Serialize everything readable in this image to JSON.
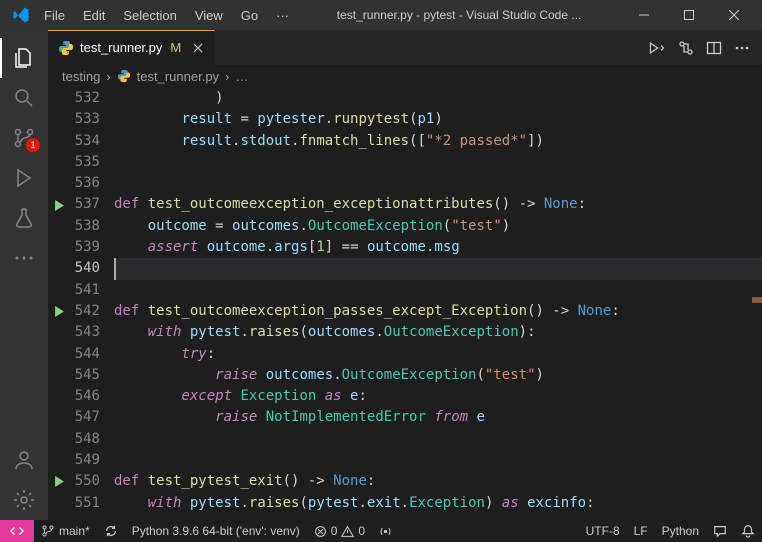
{
  "window": {
    "title": "test_runner.py - pytest - Visual Studio Code ..."
  },
  "menu": {
    "file": "File",
    "edit": "Edit",
    "selection": "Selection",
    "view": "View",
    "go": "Go",
    "more": "···"
  },
  "activity": {
    "scm_badge": "1"
  },
  "tab": {
    "filename": "test_runner.py",
    "modified_marker": "M"
  },
  "breadcrumb": {
    "folder": "testing",
    "file": "test_runner.py",
    "more": "…"
  },
  "editor": {
    "lines": [
      {
        "n": "532",
        "play": false,
        "tokens": [
          [
            "op",
            "            "
          ],
          [
            "op",
            ")"
          ]
        ]
      },
      {
        "n": "533",
        "play": false,
        "tokens": [
          [
            "op",
            "        "
          ],
          [
            "var",
            "result"
          ],
          [
            "op",
            " "
          ],
          [
            "op",
            "="
          ],
          [
            "op",
            " "
          ],
          [
            "var",
            "pytester"
          ],
          [
            "op",
            "."
          ],
          [
            "fn",
            "runpytest"
          ],
          [
            "op",
            "("
          ],
          [
            "var",
            "p1"
          ],
          [
            "op",
            ")"
          ]
        ]
      },
      {
        "n": "534",
        "play": false,
        "tokens": [
          [
            "op",
            "        "
          ],
          [
            "var",
            "result"
          ],
          [
            "op",
            "."
          ],
          [
            "var",
            "stdout"
          ],
          [
            "op",
            "."
          ],
          [
            "fn",
            "fnmatch_lines"
          ],
          [
            "op",
            "(["
          ],
          [
            "str",
            "\"*2 passed*\""
          ],
          [
            "op",
            "])"
          ]
        ]
      },
      {
        "n": "535",
        "play": false,
        "tokens": []
      },
      {
        "n": "536",
        "play": false,
        "tokens": []
      },
      {
        "n": "537",
        "play": true,
        "tokens": [
          [
            "def",
            "def "
          ],
          [
            "fn",
            "test_outcomeexception_exceptionattributes"
          ],
          [
            "op",
            "() -> "
          ],
          [
            "const",
            "None"
          ],
          [
            "op",
            ":"
          ]
        ]
      },
      {
        "n": "538",
        "play": false,
        "tokens": [
          [
            "op",
            "    "
          ],
          [
            "var",
            "outcome"
          ],
          [
            "op",
            " "
          ],
          [
            "op",
            "="
          ],
          [
            "op",
            " "
          ],
          [
            "var",
            "outcomes"
          ],
          [
            "op",
            "."
          ],
          [
            "cls",
            "OutcomeException"
          ],
          [
            "op",
            "("
          ],
          [
            "str",
            "\"test\""
          ],
          [
            "op",
            ")"
          ]
        ]
      },
      {
        "n": "539",
        "play": false,
        "tokens": [
          [
            "op",
            "    "
          ],
          [
            "kw-i",
            "assert"
          ],
          [
            "op",
            " "
          ],
          [
            "var",
            "outcome"
          ],
          [
            "op",
            "."
          ],
          [
            "var",
            "args"
          ],
          [
            "op",
            "["
          ],
          [
            "num",
            "1"
          ],
          [
            "op",
            "] "
          ],
          [
            "op",
            "=="
          ],
          [
            "op",
            " "
          ],
          [
            "var",
            "outcome"
          ],
          [
            "op",
            "."
          ],
          [
            "var",
            "msg"
          ]
        ]
      },
      {
        "n": "540",
        "play": false,
        "current": true,
        "tokens": []
      },
      {
        "n": "541",
        "play": false,
        "tokens": []
      },
      {
        "n": "542",
        "play": true,
        "tokens": [
          [
            "def",
            "def "
          ],
          [
            "fn",
            "test_outcomeexception_passes_except_Exception"
          ],
          [
            "op",
            "() -> "
          ],
          [
            "const",
            "None"
          ],
          [
            "op",
            ":"
          ]
        ]
      },
      {
        "n": "543",
        "play": false,
        "tokens": [
          [
            "op",
            "    "
          ],
          [
            "kw-i",
            "with"
          ],
          [
            "op",
            " "
          ],
          [
            "var",
            "pytest"
          ],
          [
            "op",
            "."
          ],
          [
            "fn",
            "raises"
          ],
          [
            "op",
            "("
          ],
          [
            "var",
            "outcomes"
          ],
          [
            "op",
            "."
          ],
          [
            "cls",
            "OutcomeException"
          ],
          [
            "op",
            "):"
          ]
        ]
      },
      {
        "n": "544",
        "play": false,
        "tokens": [
          [
            "op",
            "        "
          ],
          [
            "kw-i",
            "try"
          ],
          [
            "op",
            ":"
          ]
        ]
      },
      {
        "n": "545",
        "play": false,
        "tokens": [
          [
            "op",
            "            "
          ],
          [
            "kw-i",
            "raise"
          ],
          [
            "op",
            " "
          ],
          [
            "var",
            "outcomes"
          ],
          [
            "op",
            "."
          ],
          [
            "cls",
            "OutcomeException"
          ],
          [
            "op",
            "("
          ],
          [
            "str",
            "\"test\""
          ],
          [
            "op",
            ")"
          ]
        ]
      },
      {
        "n": "546",
        "play": false,
        "tokens": [
          [
            "op",
            "        "
          ],
          [
            "kw-i",
            "except"
          ],
          [
            "op",
            " "
          ],
          [
            "cls",
            "Exception"
          ],
          [
            "op",
            " "
          ],
          [
            "kw-i",
            "as"
          ],
          [
            "op",
            " "
          ],
          [
            "var",
            "e"
          ],
          [
            "op",
            ":"
          ]
        ]
      },
      {
        "n": "547",
        "play": false,
        "tokens": [
          [
            "op",
            "            "
          ],
          [
            "kw-i",
            "raise"
          ],
          [
            "op",
            " "
          ],
          [
            "cls",
            "NotImplementedError"
          ],
          [
            "op",
            " "
          ],
          [
            "kw-i",
            "from"
          ],
          [
            "op",
            " "
          ],
          [
            "var",
            "e"
          ]
        ]
      },
      {
        "n": "548",
        "play": false,
        "tokens": []
      },
      {
        "n": "549",
        "play": false,
        "tokens": []
      },
      {
        "n": "550",
        "play": true,
        "tokens": [
          [
            "def",
            "def "
          ],
          [
            "fn",
            "test_pytest_exit"
          ],
          [
            "op",
            "() -> "
          ],
          [
            "const",
            "None"
          ],
          [
            "op",
            ":"
          ]
        ]
      },
      {
        "n": "551",
        "play": false,
        "tokens": [
          [
            "op",
            "    "
          ],
          [
            "kw-i",
            "with"
          ],
          [
            "op",
            " "
          ],
          [
            "var",
            "pytest"
          ],
          [
            "op",
            "."
          ],
          [
            "fn",
            "raises"
          ],
          [
            "op",
            "("
          ],
          [
            "var",
            "pytest"
          ],
          [
            "op",
            "."
          ],
          [
            "var",
            "exit"
          ],
          [
            "op",
            "."
          ],
          [
            "cls",
            "Exception"
          ],
          [
            "op",
            ") "
          ],
          [
            "kw-i",
            "as"
          ],
          [
            "op",
            " "
          ],
          [
            "var",
            "excinfo"
          ],
          [
            "op",
            ":"
          ]
        ]
      }
    ]
  },
  "status": {
    "branch": "main*",
    "interpreter": "Python 3.9.6 64-bit ('env': venv)",
    "errors": "0",
    "warnings": "0",
    "encoding": "UTF-8",
    "eol": "LF",
    "lang": "Python"
  }
}
